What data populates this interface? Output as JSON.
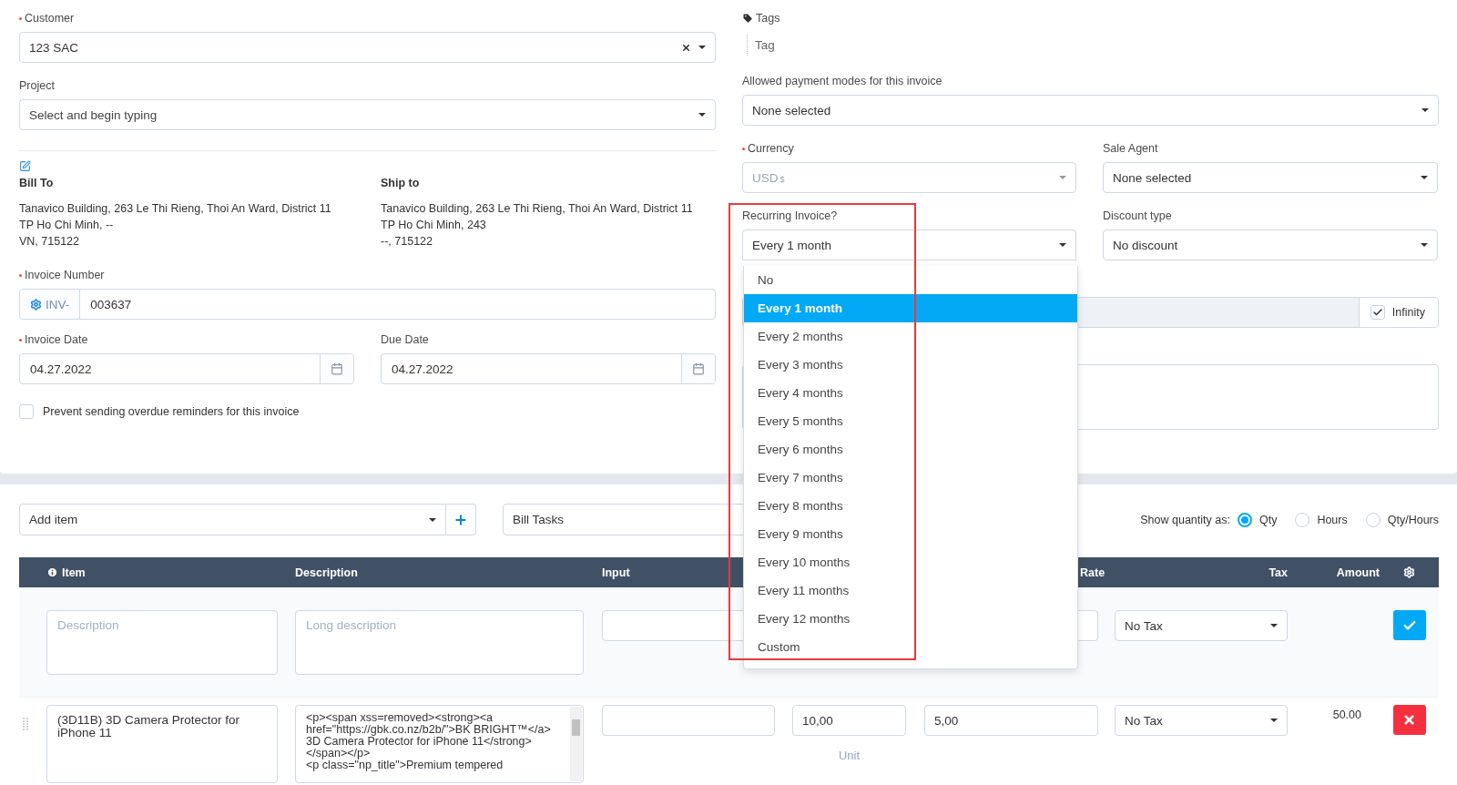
{
  "customer": {
    "label": "Customer",
    "required": true,
    "value": "123 SAC"
  },
  "project": {
    "label": "Project",
    "placeholder": "Select and begin typing"
  },
  "bill_to": {
    "title": "Bill To",
    "lines": [
      "Tanavico Building, 263 Le Thi Rieng, Thoi An Ward, District 11",
      "TP Ho Chi Minh, --",
      "VN, 715122"
    ]
  },
  "ship_to": {
    "title": "Ship to",
    "lines": [
      "Tanavico Building, 263 Le Thi Rieng, Thoi An Ward, District 11",
      "TP Ho Chi Minh, 243",
      "--, 715122"
    ]
  },
  "invoice_number": {
    "label": "Invoice Number",
    "required": true,
    "prefix": "INV-",
    "value": "003637"
  },
  "invoice_date": {
    "label": "Invoice Date",
    "required": true,
    "value": "04.27.2022"
  },
  "due_date": {
    "label": "Due Date",
    "value": "04.27.2022"
  },
  "prevent_reminders": {
    "label": "Prevent sending overdue reminders for this invoice",
    "checked": false
  },
  "tags": {
    "label": "Tags",
    "placeholder": "Tag"
  },
  "payment_modes": {
    "label": "Allowed payment modes for this invoice",
    "value": "None selected"
  },
  "currency": {
    "label": "Currency",
    "required": true,
    "value": "USD",
    "symbol": "$",
    "disabled": true
  },
  "sale_agent": {
    "label": "Sale Agent",
    "value": "None selected"
  },
  "recurring": {
    "label": "Recurring Invoice?",
    "value": "Every 1 month",
    "expanded": true,
    "options": [
      {
        "label": "No",
        "selected": false
      },
      {
        "label": "Every 1 month",
        "selected": true
      },
      {
        "label": "Every 2 months",
        "selected": false
      },
      {
        "label": "Every 3 months",
        "selected": false
      },
      {
        "label": "Every 4 months",
        "selected": false
      },
      {
        "label": "Every 5 months",
        "selected": false
      },
      {
        "label": "Every 6 months",
        "selected": false
      },
      {
        "label": "Every 7 months",
        "selected": false
      },
      {
        "label": "Every 8 months",
        "selected": false
      },
      {
        "label": "Every 9 months",
        "selected": false
      },
      {
        "label": "Every 10 months",
        "selected": false
      },
      {
        "label": "Every 11 months",
        "selected": false
      },
      {
        "label": "Every 12 months",
        "selected": false
      },
      {
        "label": "Custom",
        "selected": false
      }
    ]
  },
  "discount_type": {
    "label": "Discount type",
    "value": "No discount"
  },
  "cycles": {
    "infinity_label": "Infinity",
    "infinity_checked": true
  },
  "items_toolbar": {
    "add_item_placeholder": "Add item",
    "bill_tasks_placeholder": "Bill Tasks",
    "quantity_label": "Show quantity as:",
    "quantity_options": [
      {
        "label": "Qty",
        "selected": true
      },
      {
        "label": "Hours",
        "selected": false
      },
      {
        "label": "Qty/Hours",
        "selected": false
      }
    ]
  },
  "table": {
    "columns": {
      "item": "Item",
      "description": "Description",
      "input": "Input",
      "rate": "Rate",
      "tax": "Tax",
      "amount": "Amount"
    },
    "new_row": {
      "description_placeholder": "Description",
      "long_description_placeholder": "Long description",
      "tax": "No Tax"
    },
    "rows": [
      {
        "item": "(3D11B) 3D Camera Protector for iPhone 11",
        "description": "<p><span xss=removed><strong><a href=\"https://gbk.co.nz/b2b/\">BK BRIGHT™</a> 3D Camera Protector for iPhone 11</strong></span></p>\n<p class=\"np_title\">Premium tempered",
        "qty": "10,00",
        "unit_placeholder": "Unit",
        "rate": "5,00",
        "tax": "No Tax",
        "amount": "50.00"
      }
    ]
  }
}
